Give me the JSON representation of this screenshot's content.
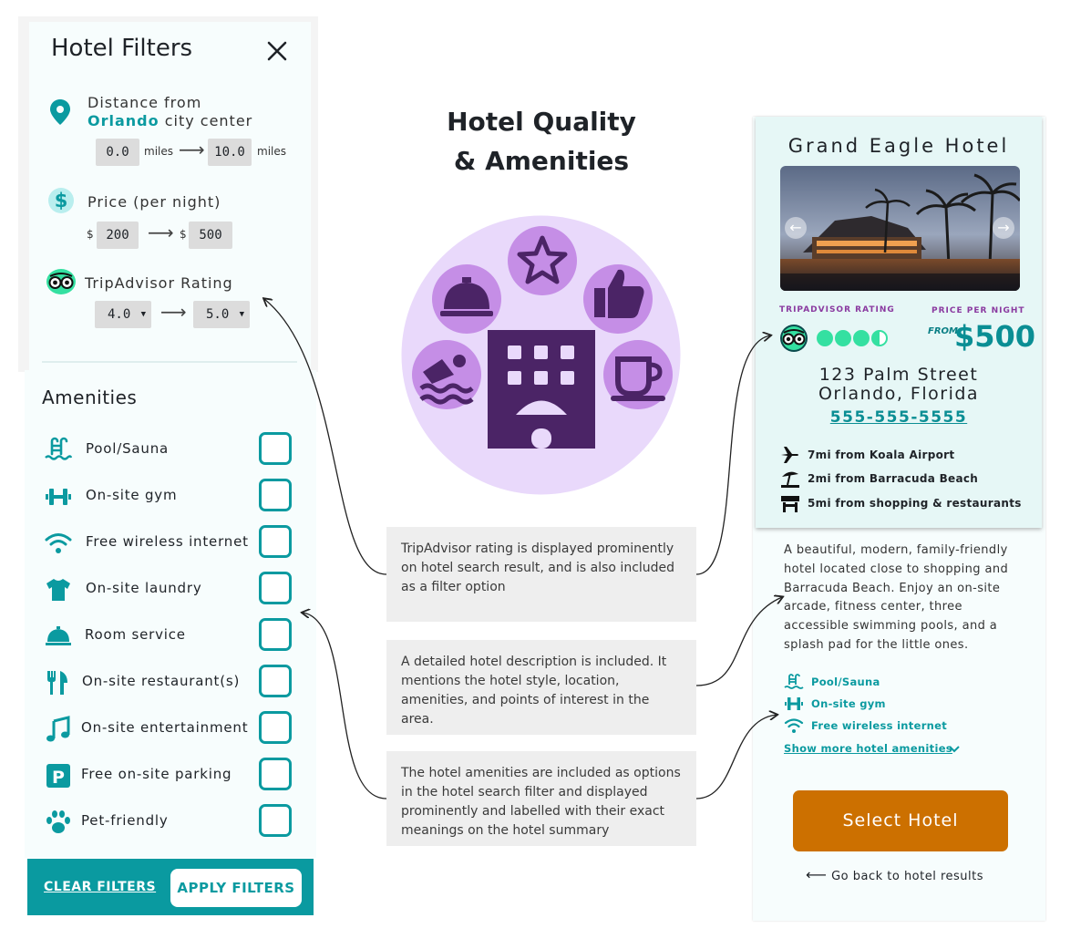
{
  "filters": {
    "title": "Hotel Filters",
    "distance": {
      "label_prefix": "Distance from",
      "city": "Orlando",
      "label_suffix": "city center",
      "min": "0.0",
      "max": "10.0",
      "unit": "miles"
    },
    "price": {
      "label": "Price (per night)",
      "currency": "$",
      "min": "200",
      "max": "500"
    },
    "rating": {
      "label": "TripAdvisor Rating",
      "min": "4.0",
      "max": "5.0"
    },
    "amenities_title": "Amenities",
    "amenities": [
      {
        "label": "Pool/Sauna",
        "icon": "pool-icon"
      },
      {
        "label": "On-site gym",
        "icon": "dumbbell-icon"
      },
      {
        "label": "Free wireless internet",
        "icon": "wifi-icon"
      },
      {
        "label": "On-site laundry",
        "icon": "shirt-icon"
      },
      {
        "label": "Room service",
        "icon": "bell-icon"
      },
      {
        "label": "On-site restaurant(s)",
        "icon": "utensils-icon"
      },
      {
        "label": "On-site entertainment",
        "icon": "music-icon"
      },
      {
        "label": "Free on-site parking",
        "icon": "parking-icon"
      },
      {
        "label": "Pet-friendly",
        "icon": "paw-icon"
      }
    ],
    "clear_label": "CLEAR FILTERS",
    "apply_label": "APPLY FILTERS"
  },
  "center": {
    "title_line1": "Hotel Quality",
    "title_line2": "& Amenities",
    "notes": [
      "TripAdvisor rating is displayed prominently on hotel search result, and is also included as a filter option",
      "A detailed hotel description is included. It mentions the hotel style, location, amenities, and points of interest in the area.",
      "The hotel amenities are included as options in the hotel search filter and displayed prominently and labelled with their exact meanings on the hotel summary"
    ]
  },
  "hotel": {
    "name": "Grand Eagle Hotel",
    "rating_label": "TRIPADVISOR RATING",
    "rating_value": 3.5,
    "price_label": "PRICE PER NIGHT",
    "price_from": "FROM",
    "price": "$500",
    "address_line1": "123 Palm Street",
    "address_line2": "Orlando, Florida",
    "phone": "555-555-5555",
    "points_of_interest": [
      {
        "label": "7mi from Koala Airport",
        "icon": "airplane-icon"
      },
      {
        "label": "2mi from Barracuda Beach",
        "icon": "beach-umbrella-icon"
      },
      {
        "label": "5mi from shopping & restaurants",
        "icon": "storefront-icon"
      }
    ],
    "description": "A beautiful, modern, family-friendly hotel located close to shopping and Barracuda Beach. Enjoy an on-site arcade, fitness center, three accessible swimming pools, and a splash pad for the little ones.",
    "amenities": [
      {
        "label": "Pool/Sauna",
        "icon": "pool-icon"
      },
      {
        "label": "On-site gym",
        "icon": "dumbbell-icon"
      },
      {
        "label": "Free wireless internet",
        "icon": "wifi-icon"
      }
    ],
    "show_more_label": "Show more hotel amenities",
    "select_label": "Select Hotel",
    "back_label": "Go back to hotel results"
  },
  "colors": {
    "teal": "#0b9aa0",
    "orange": "#cc7000",
    "purple": "#4b2466",
    "lavender": "#e9d9fb",
    "tripadvisor_green": "#34e0a1"
  }
}
